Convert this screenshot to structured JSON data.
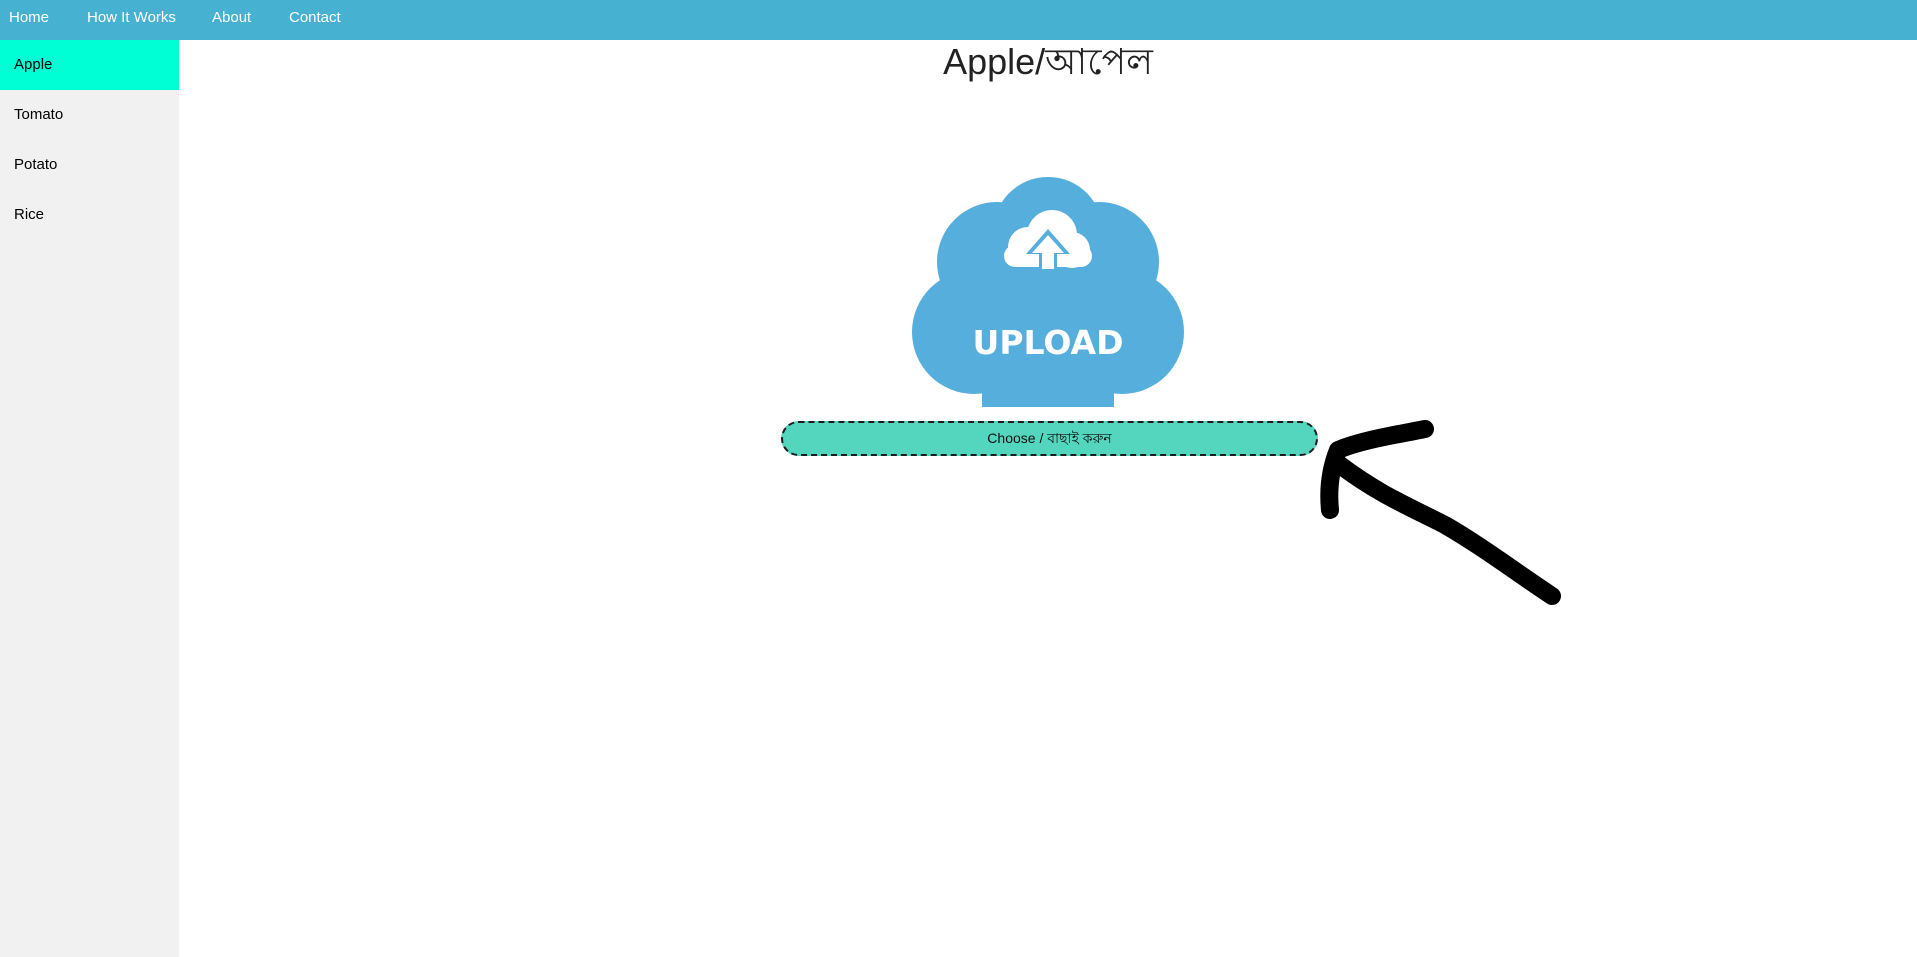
{
  "nav": {
    "items": [
      {
        "label": "Home"
      },
      {
        "label": "How It Works"
      },
      {
        "label": "About"
      },
      {
        "label": "Contact"
      }
    ]
  },
  "sidebar": {
    "items": [
      {
        "label": "Apple",
        "active": true
      },
      {
        "label": "Tomato",
        "active": false
      },
      {
        "label": "Potato",
        "active": false
      },
      {
        "label": "Rice",
        "active": false
      }
    ]
  },
  "main": {
    "title": "Apple/আপেল",
    "upload_label": "UPLOAD",
    "upload_icon": "cloud-upload-icon",
    "choose_button_label": "Choose / বাছাই করুন",
    "hint_icon": "hand-drawn-arrow-icon"
  },
  "colors": {
    "nav_bg": "#46b1d1",
    "sidebar_bg": "#f1f1f1",
    "sidebar_active": "#00ffd5",
    "cloud": "#55aedc",
    "choose_button": "#53d6bd",
    "arrow": "#000000"
  }
}
